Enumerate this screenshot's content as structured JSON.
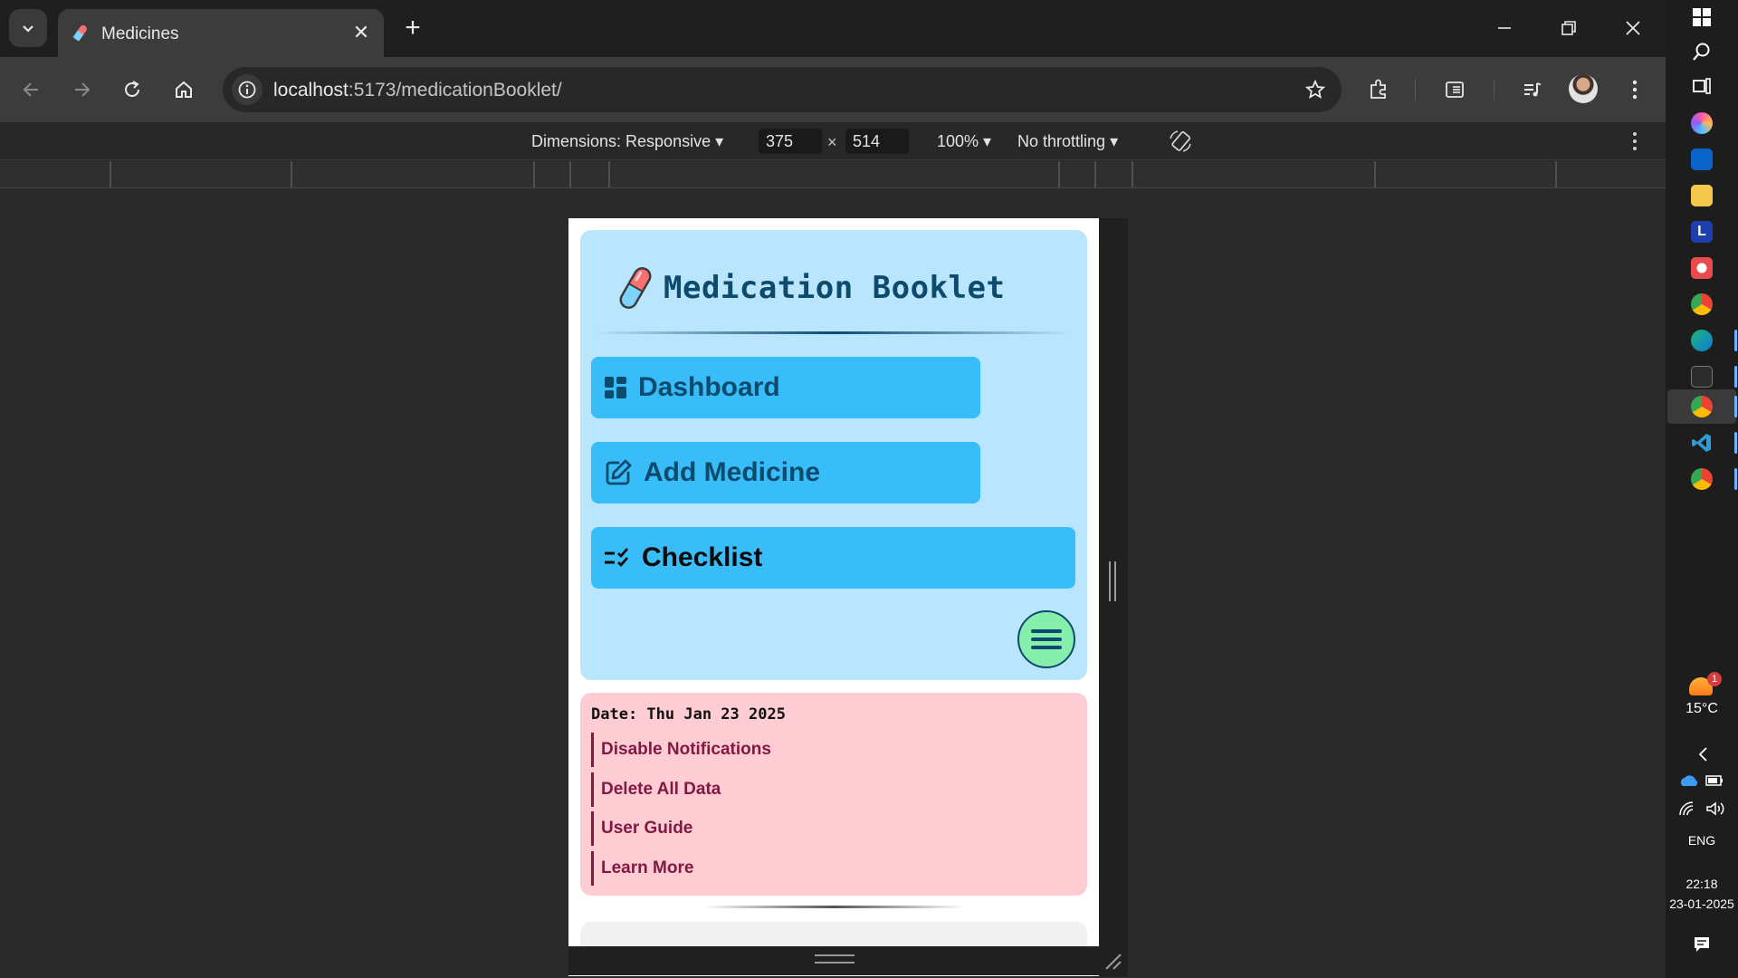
{
  "browser": {
    "tab_title": "Medicines",
    "url_host": "localhost",
    "url_path": ":5173/medicationBooklet/"
  },
  "devtools": {
    "dimensions_label": "Dimensions: Responsive",
    "width_value": "375",
    "times": "×",
    "height_value": "514",
    "zoom": "100%",
    "throttling": "No throttling"
  },
  "app": {
    "title": "Medication Booklet",
    "nav": [
      {
        "label": "Dashboard",
        "icon": "dashboard-icon",
        "color": "#0c4a6e"
      },
      {
        "label": "Add Medicine",
        "icon": "edit-icon",
        "color": "#0c4a6e"
      },
      {
        "label": "Checklist",
        "icon": "checklist-icon",
        "color": "#0a0a0a"
      }
    ],
    "settings": {
      "date_text": "Date: Thu Jan 23 2025",
      "links": [
        "Disable Notifications",
        "Delete All Data",
        "User Guide",
        "Learn More"
      ]
    },
    "colors": {
      "nav_card": "#bae6fd",
      "nav_button": "#38bdf8",
      "menu_fab": "#86efac",
      "settings_card": "#fecdd3",
      "settings_text": "#831843"
    }
  },
  "taskbar": {
    "weather_badge": "1",
    "temperature": "15°C",
    "language": "ENG",
    "time": "22:18",
    "date": "23-01-2025"
  }
}
